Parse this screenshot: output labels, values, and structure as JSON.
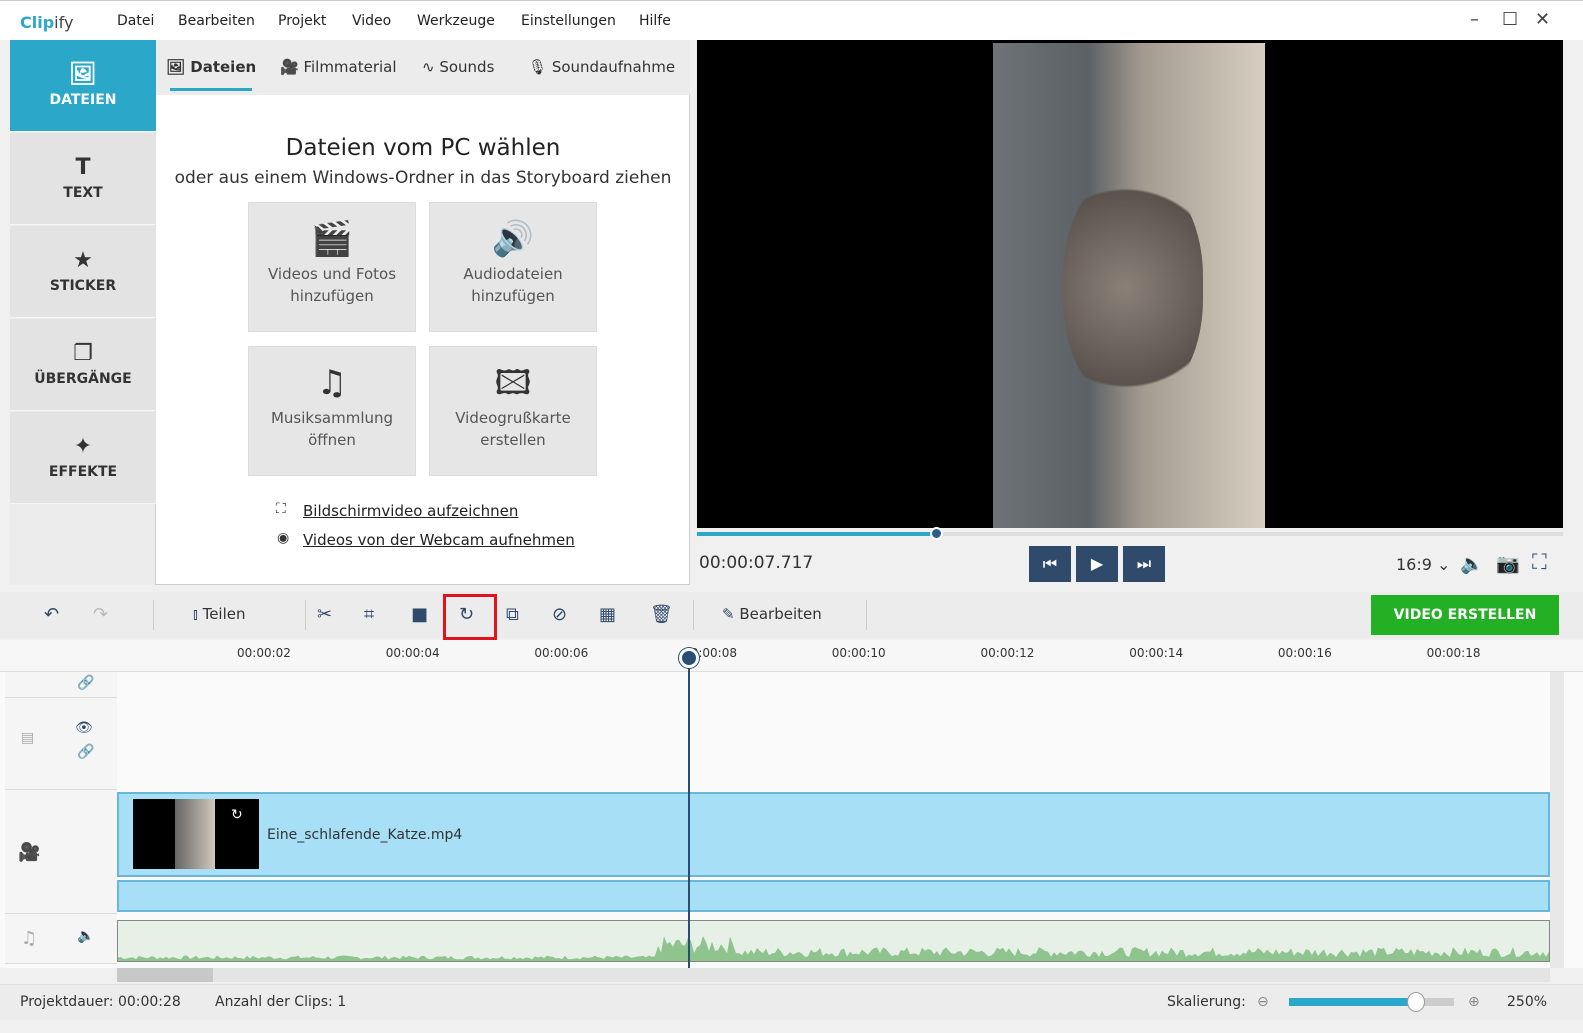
{
  "app": {
    "logo": "Clipify"
  },
  "menu": [
    "Datei",
    "Bearbeiten",
    "Projekt",
    "Video",
    "Werkzeuge",
    "Einstellungen",
    "Hilfe"
  ],
  "sidebar": [
    {
      "label": "DATEIEN",
      "icon": "image-icon"
    },
    {
      "label": "TEXT",
      "icon": "text-icon"
    },
    {
      "label": "STICKER",
      "icon": "star-icon"
    },
    {
      "label": "ÜBERGÄNGE",
      "icon": "transitions-icon"
    },
    {
      "label": "EFFEKTE",
      "icon": "magic-wand-icon"
    }
  ],
  "tabs": [
    "Dateien",
    "Filmmaterial",
    "Sounds",
    "Soundaufnahme"
  ],
  "panel": {
    "title": "Dateien vom PC wählen",
    "subtitle": "oder aus einem Windows-Ordner in das Storyboard ziehen",
    "tiles": [
      [
        "Videos und Fotos",
        "hinzufügen"
      ],
      [
        "Audiodateien",
        "hinzufügen"
      ],
      [
        "Musiksammlung",
        "öffnen"
      ],
      [
        "Videogrußkarte",
        "erstellen"
      ]
    ],
    "links": [
      "Bildschirmvideo aufzeichnen",
      "Videos von der Webcam aufnehmen"
    ]
  },
  "player": {
    "time": "00:00:07.717",
    "progress": 0.277,
    "aspect": "16:9"
  },
  "toolbar": {
    "split": "Teilen",
    "edit": "Bearbeiten",
    "create": "VIDEO ERSTELLEN",
    "accent": "#24b024",
    "highlight": "#e0141e"
  },
  "ruler": [
    "00:00:02",
    "00:00:04",
    "00:00:06",
    "00:00:08",
    "00:00:10",
    "00:00:12",
    "00:00:14",
    "00:00:16",
    "00:00:18"
  ],
  "clip": {
    "name": "Eine_schlafende_Katze.mp4"
  },
  "status": {
    "duration": "Projektdauer:  00:00:28",
    "clips": "Anzahl der Clips: 1",
    "scale_label": "Skalierung:",
    "scale": "250%",
    "scale_fraction": 0.77
  }
}
